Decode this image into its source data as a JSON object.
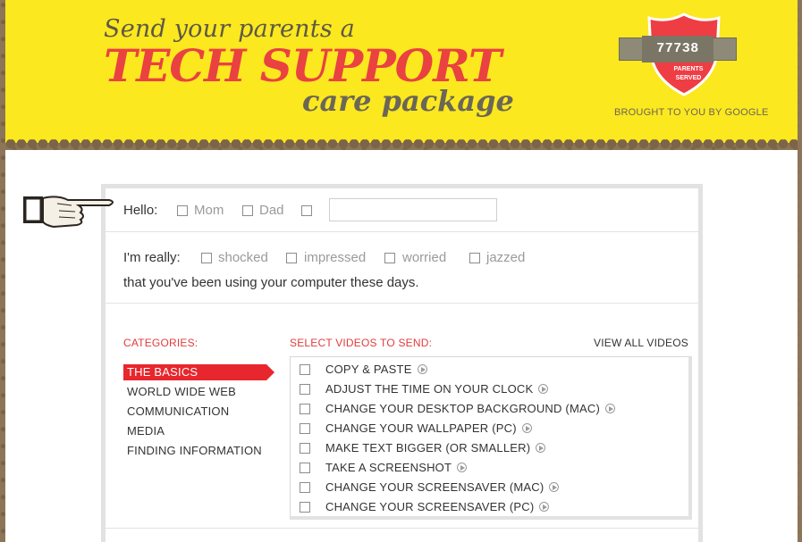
{
  "header": {
    "tagline": "Send your parents a",
    "headline": "TECH SUPPORT",
    "subline": "care package",
    "counter": "77738",
    "counter_caption_1": "PARENTS",
    "counter_caption_2": "SERVED",
    "brought_by": "BROUGHT TO YOU BY GOOGLE"
  },
  "hello": {
    "label": "Hello:",
    "options": [
      "Mom",
      "Dad"
    ],
    "name_value": ""
  },
  "feeling": {
    "label": "I'm really:",
    "options": [
      "shocked",
      "impressed",
      "worried",
      "jazzed"
    ],
    "sentence": "that you've been using your computer these days."
  },
  "categories": {
    "heading": "CATEGORIES:",
    "items": [
      "THE BASICS",
      "WORLD WIDE WEB",
      "COMMUNICATION",
      "MEDIA",
      "FINDING INFORMATION"
    ]
  },
  "videos": {
    "heading": "SELECT VIDEOS TO SEND:",
    "view_all": "VIEW ALL VIDEOS",
    "items": [
      "COPY & PASTE",
      "ADJUST THE TIME ON YOUR CLOCK",
      "CHANGE YOUR DESKTOP BACKGROUND (MAC)",
      "CHANGE YOUR WALLPAPER (PC)",
      "MAKE TEXT BIGGER (OR SMALLER)",
      "TAKE A SCREENSHOT",
      "CHANGE YOUR SCREENSAVER (MAC)",
      "CHANGE YOUR SCREENSAVER (PC)"
    ]
  },
  "colors": {
    "header_yellow": "#fbe81f",
    "accent_red": "#e8262d",
    "shield_red": "#ef3d44"
  },
  "icons": [
    "pointing-hand-icon",
    "shield-badge-icon",
    "play-icon"
  ]
}
